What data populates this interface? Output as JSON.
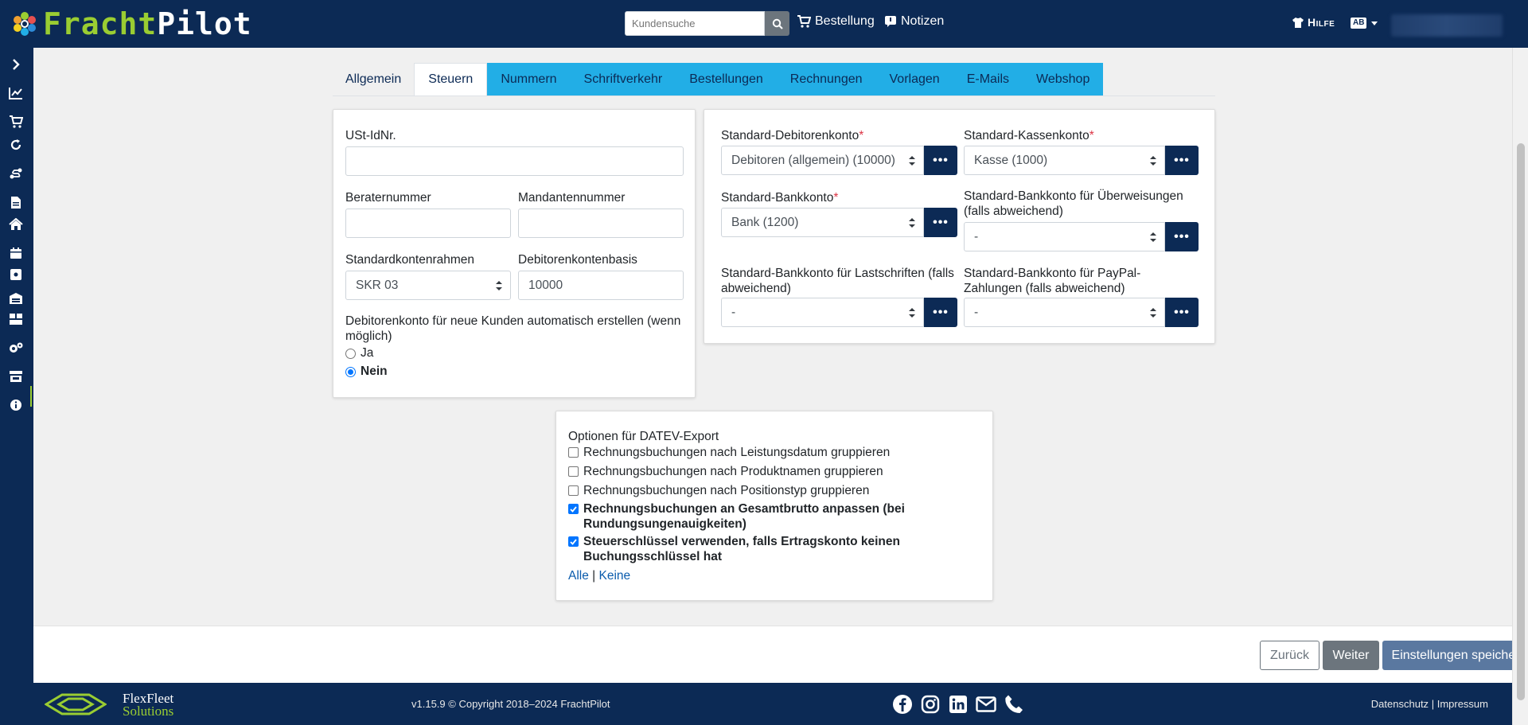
{
  "app": {
    "logo_part1": "Fracht",
    "logo_part2": "Pilot"
  },
  "topbar": {
    "search_placeholder": "Kundensuche",
    "order_label": "Bestellung",
    "notes_label": "Notizen",
    "help_label": "Hilfe",
    "lang_label": "AB"
  },
  "tabs": [
    {
      "label": "Allgemein"
    },
    {
      "label": "Steuern"
    },
    {
      "label": "Nummern"
    },
    {
      "label": "Schriftverkehr"
    },
    {
      "label": "Bestellungen"
    },
    {
      "label": "Rechnungen"
    },
    {
      "label": "Vorlagen"
    },
    {
      "label": "E-Mails"
    },
    {
      "label": "Webshop"
    }
  ],
  "active_tab": "Steuern",
  "left_card": {
    "vat_label": "USt-IdNr.",
    "vat_value": "",
    "advisor_label": "Beraternummer",
    "advisor_value": "",
    "client_label": "Mandantennummer",
    "client_value": "",
    "chart_label": "Standardkontenrahmen",
    "chart_value": "SKR 03",
    "debtor_base_label": "Debitorenkontenbasis",
    "debtor_base_value": "10000",
    "auto_create_label": "Debitorenkonto für neue Kunden automatisch erstellen (wenn möglich)",
    "option_yes": "Ja",
    "option_no": "Nein",
    "selected": "Nein"
  },
  "right_card": {
    "debtor_account_label": "Standard-Debitorenkonto",
    "debtor_account_value": "Debitoren (allgemein) (10000)",
    "cash_account_label": "Standard-Kassenkonto",
    "cash_account_value": "Kasse (1000)",
    "bank_account_label": "Standard-Bankkonto",
    "bank_account_value": "Bank (1200)",
    "bank_transfer_label": "Standard-Bankkonto für Überweisungen (falls abweichend)",
    "bank_transfer_value": "-",
    "bank_debit_label": "Standard-Bankkonto für Lastschriften (falls abweichend)",
    "bank_debit_value": "-",
    "paypal_label": "Standard-Bankkonto für PayPal-Zahlungen (falls abweichend)",
    "paypal_value": "-",
    "required_mark": "*",
    "dots_label": "•••"
  },
  "datev": {
    "title": "Optionen für DATEV-Export",
    "options": [
      {
        "label": "Rechnungsbuchungen nach Leistungsdatum gruppieren",
        "checked": false
      },
      {
        "label": "Rechnungsbuchungen nach Produktnamen gruppieren",
        "checked": false
      },
      {
        "label": "Rechnungsbuchungen nach Positionstyp gruppieren",
        "checked": false
      },
      {
        "label": "Rechnungsbuchungen an Gesamtbrutto anpassen (bei Rundungsungenauigkeiten)",
        "checked": true
      },
      {
        "label": "Steuerschlüssel verwenden, falls Ertragskonto keinen Buchungsschlüssel hat",
        "checked": true
      }
    ],
    "all_label": "Alle",
    "separator": "|",
    "none_label": "Keine"
  },
  "actions": {
    "back": "Zurück",
    "next": "Weiter",
    "save": "Einstellungen speichern"
  },
  "footer": {
    "brand_line1": "FlexFleet",
    "brand_line2": "Solutions",
    "copyright": "v1.15.9 © Copyright 2018–2024 FrachtPilot",
    "privacy": "Datenschutz",
    "separator": "|",
    "imprint": "Impressum"
  },
  "colors": {
    "navy": "#0c2a55",
    "accent_green": "#9acd32",
    "tab_blue": "#22aee6"
  },
  "icons": {
    "sidebar": [
      "chevron-right-icon",
      "chart-icon",
      "cart-icon",
      "refresh-icon",
      "route-icon",
      "document-icon",
      "home-icon",
      "calendar-icon",
      "box-icon",
      "warehouse-icon",
      "grid-icon",
      "settings-icon",
      "store-icon",
      "info-icon"
    ],
    "social": [
      "facebook-icon",
      "instagram-icon",
      "linkedin-icon",
      "mail-icon",
      "phone-icon"
    ]
  }
}
